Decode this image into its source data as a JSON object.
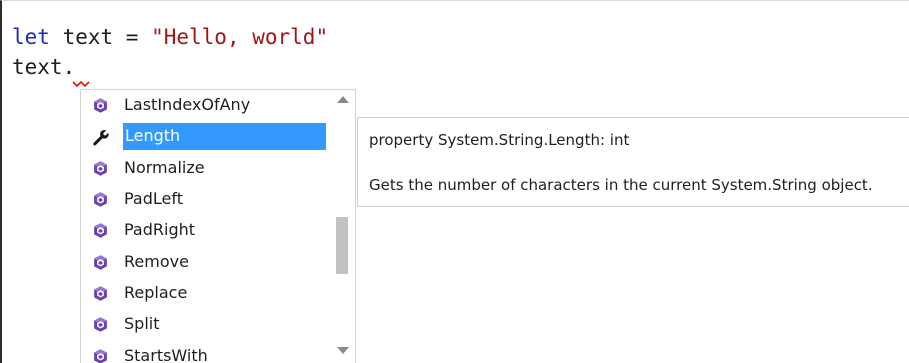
{
  "editor": {
    "line1": {
      "keyword": "let",
      "identifier": " text = ",
      "string": "\"Hello, world\""
    },
    "line2": {
      "text": "text."
    }
  },
  "completion": {
    "selected_index": 1,
    "items": [
      {
        "label": "LastIndexOfAny",
        "icon": "method-icon"
      },
      {
        "label": "Length",
        "icon": "property-wrench-icon"
      },
      {
        "label": "Normalize",
        "icon": "method-icon"
      },
      {
        "label": "PadLeft",
        "icon": "method-icon"
      },
      {
        "label": "PadRight",
        "icon": "method-icon"
      },
      {
        "label": "Remove",
        "icon": "method-icon"
      },
      {
        "label": "Replace",
        "icon": "method-icon"
      },
      {
        "label": "Split",
        "icon": "method-icon"
      },
      {
        "label": "StartsWith",
        "icon": "method-icon"
      }
    ]
  },
  "tooltip": {
    "signature": "property System.String.Length: int",
    "description": "Gets the number of characters in the current System.String object."
  },
  "colors": {
    "keyword": "#1f2ab8",
    "string": "#a31515",
    "selection": "#3399ff",
    "method_icon": "#6c3fb6",
    "squiggle": "#e51400"
  }
}
